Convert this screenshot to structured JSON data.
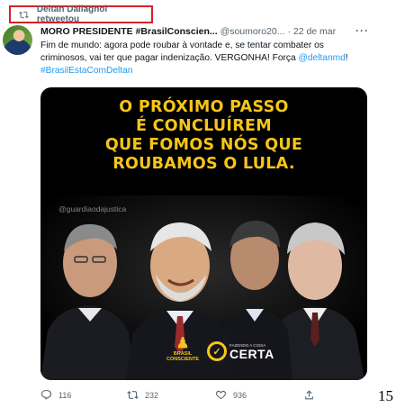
{
  "retweet": {
    "label": "Deltan Dallagnol retweetou",
    "icon": "retweet-icon"
  },
  "tweet": {
    "display_name": "MORO PRESIDENTE #BrasilConscien...",
    "handle": "@soumoro20...",
    "separator": "·",
    "date": "22 de mar",
    "more_label": "···",
    "text_line1": "Fim de mundo: agora pode roubar à vontade e, se tentar combater os",
    "text_line2": "criminosos, vai ter que pagar indenização. VERGONHA! Força ",
    "mention": "@deltanmd",
    "text_line2_end": "!",
    "hashtag": "#BrasilEstaComDeltan"
  },
  "media": {
    "headline": [
      "O PRÓXIMO PASSO",
      "É CONCLUÍREM",
      "QUE FOMOS NÓS QUE",
      "ROUBAMOS O LULA."
    ],
    "watermark": "@guardiaodajustica",
    "logo_left": {
      "line1": "BRASIL",
      "line2": "CONSCIENTE"
    },
    "logo_right": {
      "small": "FAZENDO A COISA",
      "big": "CERTA"
    },
    "accent_color": "#f5c518"
  },
  "actions": {
    "reply_count": "116",
    "retweet_count": "232",
    "like_count": "936"
  },
  "page_number": "15"
}
